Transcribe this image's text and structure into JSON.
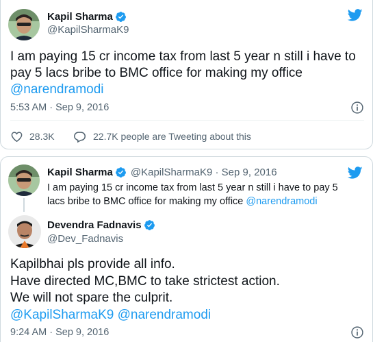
{
  "tweet1": {
    "author_name": "Kapil Sharma",
    "author_handle": "@KapilSharmaK9",
    "text_line1": "I am paying 15 cr income tax from last 5 year n still i have to",
    "text_line2": "pay 5 lacs bribe to BMC office for making my office",
    "mention": "@narendramodi",
    "timestamp": "5:53 AM · Sep 9, 2016",
    "likes": "28.3K",
    "tweeting_count": "22.7K people are Tweeting about this"
  },
  "tweet2": {
    "quoted": {
      "author_name": "Kapil Sharma",
      "author_handle": "@KapilSharmaK9 · Sep 9, 2016",
      "text_line1": "I am paying 15 cr income tax from last 5 year n still i have to pay 5",
      "text_line2": "lacs bribe to BMC office for making my office ",
      "mention": "@narendramodi"
    },
    "reply": {
      "author_name": "Devendra Fadnavis",
      "author_handle": "@Dev_Fadnavis",
      "line1": "Kapilbhai pls provide all info.",
      "line2": "Have directed MC,BMC to take strictest action.",
      "line3": "We will not spare the culprit.",
      "mention1": "@KapilSharmaK9",
      "mention2": "@narendramodi",
      "timestamp": "9:24 AM · Sep 9, 2016"
    }
  },
  "colors": {
    "accent": "#1d9bf0",
    "secondary_text": "#536471",
    "border": "#cfd9de"
  },
  "icons": [
    "twitter-bird-icon",
    "verified-badge-icon",
    "info-icon",
    "heart-icon",
    "reply-bubble-icon"
  ]
}
